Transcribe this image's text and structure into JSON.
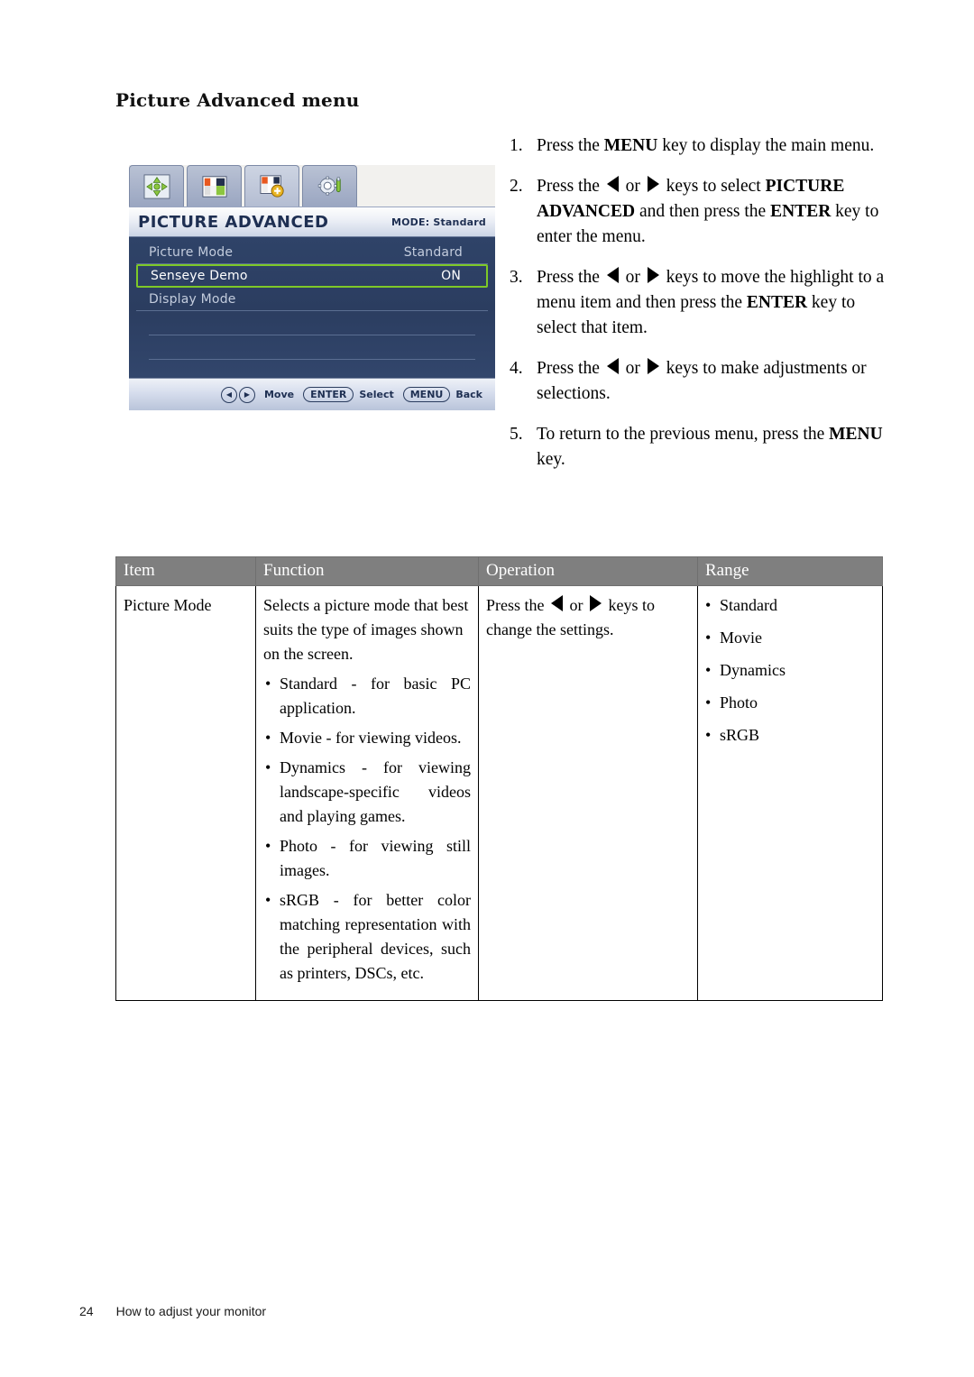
{
  "heading": "Picture Advanced menu",
  "osd": {
    "tabs": [
      {
        "name": "display-tab",
        "icon": "four-way-arrow-icon",
        "active": false
      },
      {
        "name": "picture-tab",
        "icon": "color-swatch-icon",
        "active": false
      },
      {
        "name": "picture-advanced-tab",
        "icon": "color-swatch-plus-icon",
        "active": true
      },
      {
        "name": "system-tab",
        "icon": "gear-tool-icon",
        "active": false
      }
    ],
    "title": "PICTURE ADVANCED",
    "mode_label": "MODE: Standard",
    "rows": [
      {
        "label": "Picture Mode",
        "value": "Standard",
        "highlighted": false
      },
      {
        "label": "Senseye Demo",
        "value": "ON",
        "highlighted": true
      },
      {
        "label": "Display Mode",
        "value": "",
        "highlighted": false
      }
    ],
    "footer": {
      "move_label": "Move",
      "enter_key": "ENTER",
      "select_label": "Select",
      "menu_key": "MENU",
      "back_label": "Back",
      "left_arrow": "◀",
      "right_arrow": "▶"
    },
    "highlight_color": "#7ec927",
    "body_color": "#2b3d60"
  },
  "steps": [
    {
      "num": "1.",
      "parts": [
        {
          "t": "Press the "
        },
        {
          "t": "MENU",
          "bold": true
        },
        {
          "t": " key to display the main menu."
        }
      ]
    },
    {
      "num": "2.",
      "parts": [
        {
          "t": "Press the "
        },
        {
          "t": "",
          "icon": "left-arrow-key-icon"
        },
        {
          "t": " or "
        },
        {
          "t": "",
          "icon": "right-arrow-key-icon"
        },
        {
          "t": " keys to select "
        },
        {
          "t": "PICTURE ADVANCED",
          "bold": true
        },
        {
          "t": " and then press the "
        },
        {
          "t": "ENTER",
          "bold": true
        },
        {
          "t": " key to enter the menu."
        }
      ]
    },
    {
      "num": "3.",
      "parts": [
        {
          "t": "Press the "
        },
        {
          "t": "",
          "icon": "left-arrow-key-icon"
        },
        {
          "t": " or "
        },
        {
          "t": "",
          "icon": "right-arrow-key-icon"
        },
        {
          "t": " keys to move the highlight to a menu item and then press the "
        },
        {
          "t": "ENTER",
          "bold": true
        },
        {
          "t": " key to select that item."
        }
      ]
    },
    {
      "num": "4.",
      "parts": [
        {
          "t": "Press the "
        },
        {
          "t": "",
          "icon": "left-arrow-key-icon"
        },
        {
          "t": " or "
        },
        {
          "t": "",
          "icon": "right-arrow-key-icon"
        },
        {
          "t": " keys to make adjustments or selections."
        }
      ]
    },
    {
      "num": "5.",
      "parts": [
        {
          "t": "To return to the previous menu, press the "
        },
        {
          "t": "MENU",
          "bold": true
        },
        {
          "t": " key."
        }
      ]
    }
  ],
  "table": {
    "headers": [
      "Item",
      "Function",
      "Operation",
      "Range"
    ],
    "row": {
      "item": "Picture Mode",
      "function_intro": "Selects a picture mode that best suits the type of images shown on the screen.",
      "function_bullets": [
        "Standard - for basic PC application.",
        "Movie - for viewing videos.",
        "Dynamics - for viewing landscape-specific videos and playing games.",
        "Photo - for viewing still images.",
        "sRGB - for better color matching representation with the peripheral devices, such as printers, DSCs, etc."
      ],
      "operation_prefix": "Press the ",
      "operation_middle": " or ",
      "operation_suffix": " keys to change the settings.",
      "range": [
        "Standard",
        "Movie",
        "Dynamics",
        "Photo",
        "sRGB"
      ]
    }
  },
  "footer": {
    "page_number": "24",
    "section": "How to adjust your monitor"
  }
}
